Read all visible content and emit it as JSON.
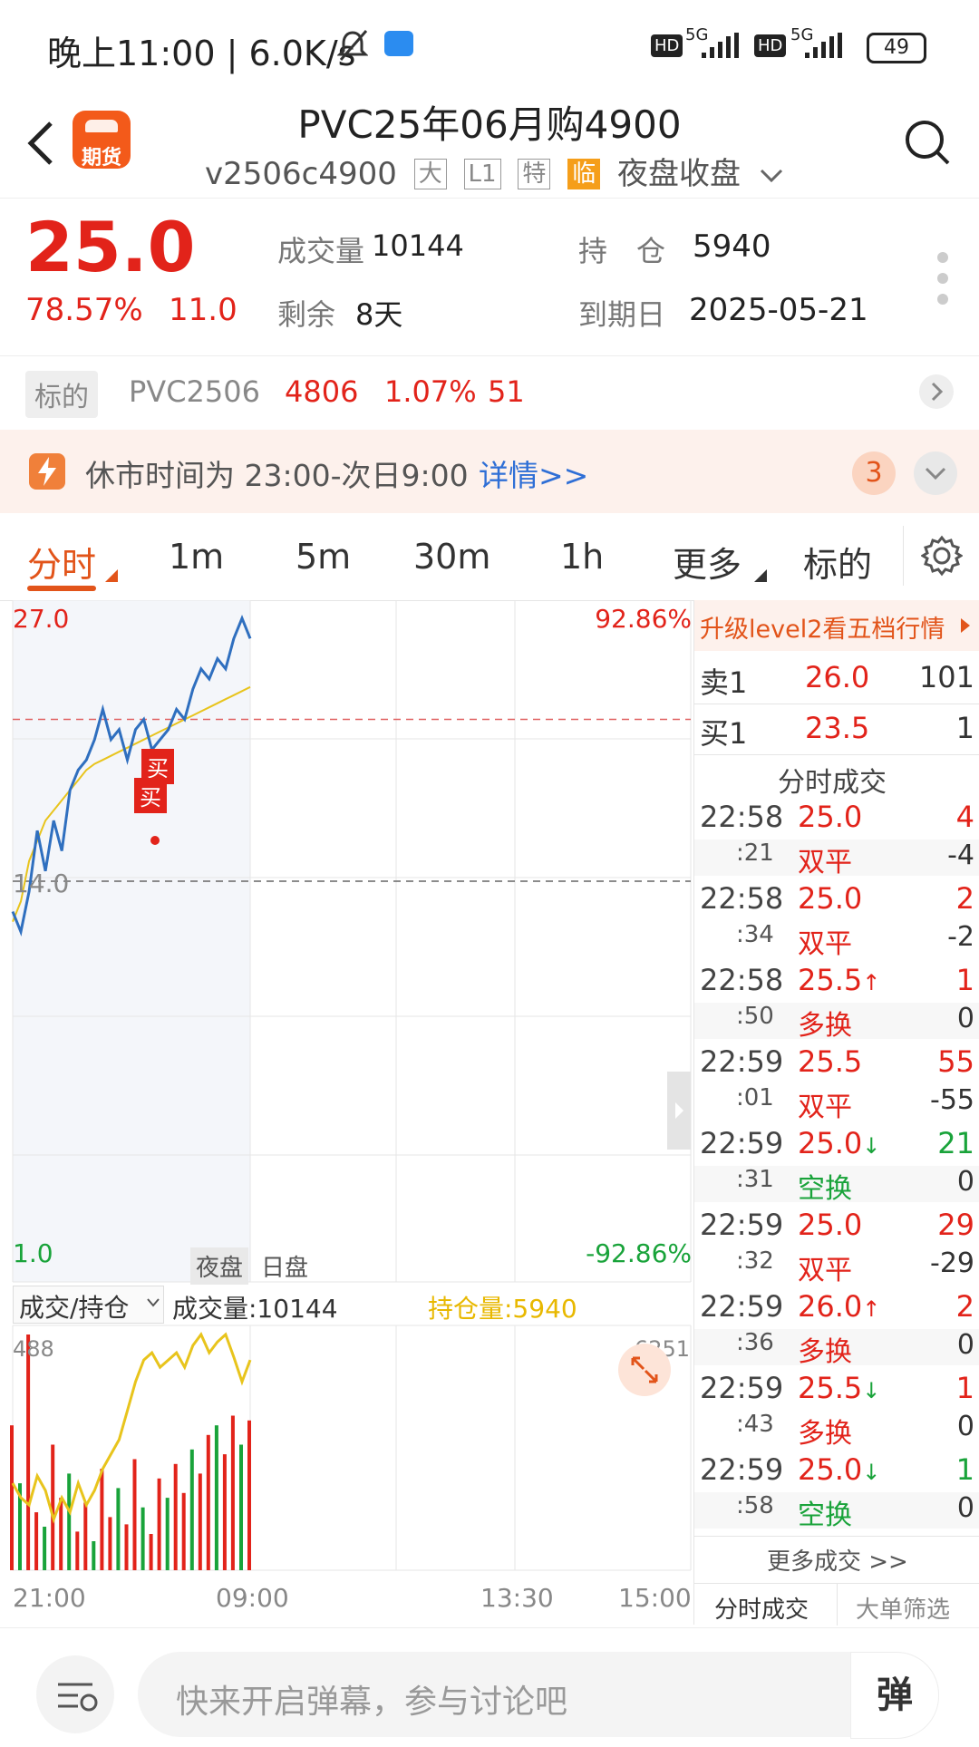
{
  "status_bar": {
    "time": "晚上11:00",
    "speed": "6.0K/s",
    "battery": "49",
    "net1": "5G",
    "net2": "5G",
    "hd": "HD"
  },
  "header": {
    "title": "PVC25年06月购4900",
    "code": "v2506c4900",
    "tags": [
      "大",
      "L1",
      "特"
    ],
    "tag_special": "临",
    "session": "夜盘收盘",
    "logo_text": "期货"
  },
  "quote": {
    "price": "25.0",
    "change_pct": "78.57%",
    "change": "11.0",
    "volume_label": "成交量",
    "volume": "10144",
    "oi_label": "持　仓",
    "oi": "5940",
    "remain_label": "剩余",
    "remain": "8天",
    "expiry_label": "到期日",
    "expiry": "2025-05-21"
  },
  "underlying": {
    "label": "标的",
    "code": "PVC2506",
    "price": "4806",
    "pct": "1.07%",
    "change": "51"
  },
  "notice": {
    "text": "休市时间为 23:00-次日9:00",
    "link": "详情>>",
    "badge": "3"
  },
  "tabs": [
    {
      "label": "分时",
      "active": true
    },
    {
      "label": "1m"
    },
    {
      "label": "5m"
    },
    {
      "label": "30m"
    },
    {
      "label": "1h"
    },
    {
      "label": "更多"
    },
    {
      "label": "标的"
    }
  ],
  "chart": {
    "y_top": "27.0",
    "y_mid": "14.0",
    "y_bottom": "1.0",
    "pct_top": "92.86%",
    "pct_bottom": "-92.86%",
    "session_night": "夜盘",
    "session_day": "日盘",
    "markers": [
      "买",
      "买"
    ],
    "sub_selector": "成交/持仓",
    "sub_volume": "成交量:10144",
    "sub_oi": "持仓量:5940",
    "sub_left_max": "488",
    "sub_right_max": "6251",
    "x_labels": [
      "21:00",
      "09:00",
      "13:30",
      "15:00"
    ]
  },
  "chart_data": {
    "type": "line",
    "title": "",
    "x_range": [
      "21:00",
      "15:00"
    ],
    "y_range": [
      1.0,
      27.0
    ],
    "ref_prev": 14.0,
    "ref_cur": 22.0,
    "series": [
      {
        "values": [
          12.5,
          11.5,
          13.5,
          16.5,
          14.5,
          17.0,
          15.5,
          18.5,
          19.5,
          20.0,
          21.0,
          22.5,
          21.0,
          21.5,
          20.0,
          21.5,
          22.0,
          20.5,
          21.0,
          21.5,
          22.5,
          22.0,
          23.5,
          24.5,
          24.0,
          25.0,
          24.5,
          26.0,
          27.0,
          26.0
        ]
      },
      {
        "values": [
          12.0,
          13.0,
          15.0,
          16.0,
          17.0,
          17.5,
          18.0,
          18.5,
          19.0,
          19.5,
          19.8,
          20.0,
          20.2,
          20.4,
          20.6,
          20.8,
          21.0,
          21.2,
          21.4,
          21.6,
          21.8,
          22.0,
          22.2,
          22.4,
          22.6,
          22.8,
          23.0,
          23.2,
          23.4,
          23.6
        ]
      }
    ],
    "volume_bars": [
      300,
      180,
      488,
      120,
      90,
      260,
      150,
      200,
      80,
      140,
      60,
      210,
      110,
      170,
      95,
      230,
      130,
      75,
      190,
      150,
      220,
      160,
      250,
      200,
      280,
      300,
      240,
      320,
      260,
      310
    ],
    "oi_line": [
      4200,
      4000,
      3900,
      4300,
      4100,
      3700,
      4000,
      3800,
      4200,
      3900,
      4100,
      4400,
      4600,
      4800,
      5200,
      5600,
      5900,
      6000,
      5800,
      5900,
      6000,
      5800,
      6100,
      6251,
      6000,
      6150,
      6251,
      5940,
      5600,
      5900
    ]
  },
  "panel": {
    "upgrade": "升级level2看五档行情",
    "sell_label": "卖1",
    "sell_price": "26.0",
    "sell_qty": "101",
    "buy_label": "买1",
    "buy_price": "23.5",
    "buy_qty": "1",
    "trades_title": "分时成交",
    "trades": [
      {
        "time": "22:58",
        "sec": ":21",
        "price": "25.0",
        "arrow": "",
        "vol": "4",
        "vol_color": "red",
        "kind": "双平",
        "kind_color": "red",
        "oi": "-4"
      },
      {
        "time": "22:58",
        "sec": ":34",
        "price": "25.0",
        "arrow": "",
        "vol": "2",
        "vol_color": "red",
        "kind": "双平",
        "kind_color": "red",
        "oi": "-2"
      },
      {
        "time": "22:58",
        "sec": ":50",
        "price": "25.5",
        "arrow": "↑",
        "vol": "1",
        "vol_color": "red",
        "kind": "多换",
        "kind_color": "red",
        "oi": "0"
      },
      {
        "time": "22:59",
        "sec": ":01",
        "price": "25.5",
        "arrow": "",
        "vol": "55",
        "vol_color": "red",
        "kind": "双平",
        "kind_color": "red",
        "oi": "-55"
      },
      {
        "time": "22:59",
        "sec": ":31",
        "price": "25.0",
        "arrow": "↓",
        "vol": "21",
        "vol_color": "green",
        "kind": "空换",
        "kind_color": "green",
        "oi": "0"
      },
      {
        "time": "22:59",
        "sec": ":32",
        "price": "25.0",
        "arrow": "",
        "vol": "29",
        "vol_color": "red",
        "kind": "双平",
        "kind_color": "red",
        "oi": "-29"
      },
      {
        "time": "22:59",
        "sec": ":36",
        "price": "26.0",
        "arrow": "↑",
        "vol": "2",
        "vol_color": "red",
        "kind": "多换",
        "kind_color": "red",
        "oi": "0"
      },
      {
        "time": "22:59",
        "sec": ":43",
        "price": "25.5",
        "arrow": "↓",
        "vol": "1",
        "vol_color": "red",
        "kind": "多换",
        "kind_color": "red",
        "oi": "0"
      },
      {
        "time": "22:59",
        "sec": ":58",
        "price": "25.0",
        "arrow": "↓",
        "vol": "1",
        "vol_color": "green",
        "kind": "空换",
        "kind_color": "green",
        "oi": "0"
      }
    ],
    "more": "更多成交 >>",
    "tab1": "分时成交",
    "tab2": "大单筛选"
  },
  "bottom": {
    "placeholder": "快来开启弹幕，参与讨论吧",
    "danmu": "弹"
  },
  "colors": {
    "accent": "#e2541a",
    "up": "#e2231a",
    "down": "#19a33a",
    "price_line": "#2f6fbf",
    "avg_line": "#e8c41c"
  }
}
